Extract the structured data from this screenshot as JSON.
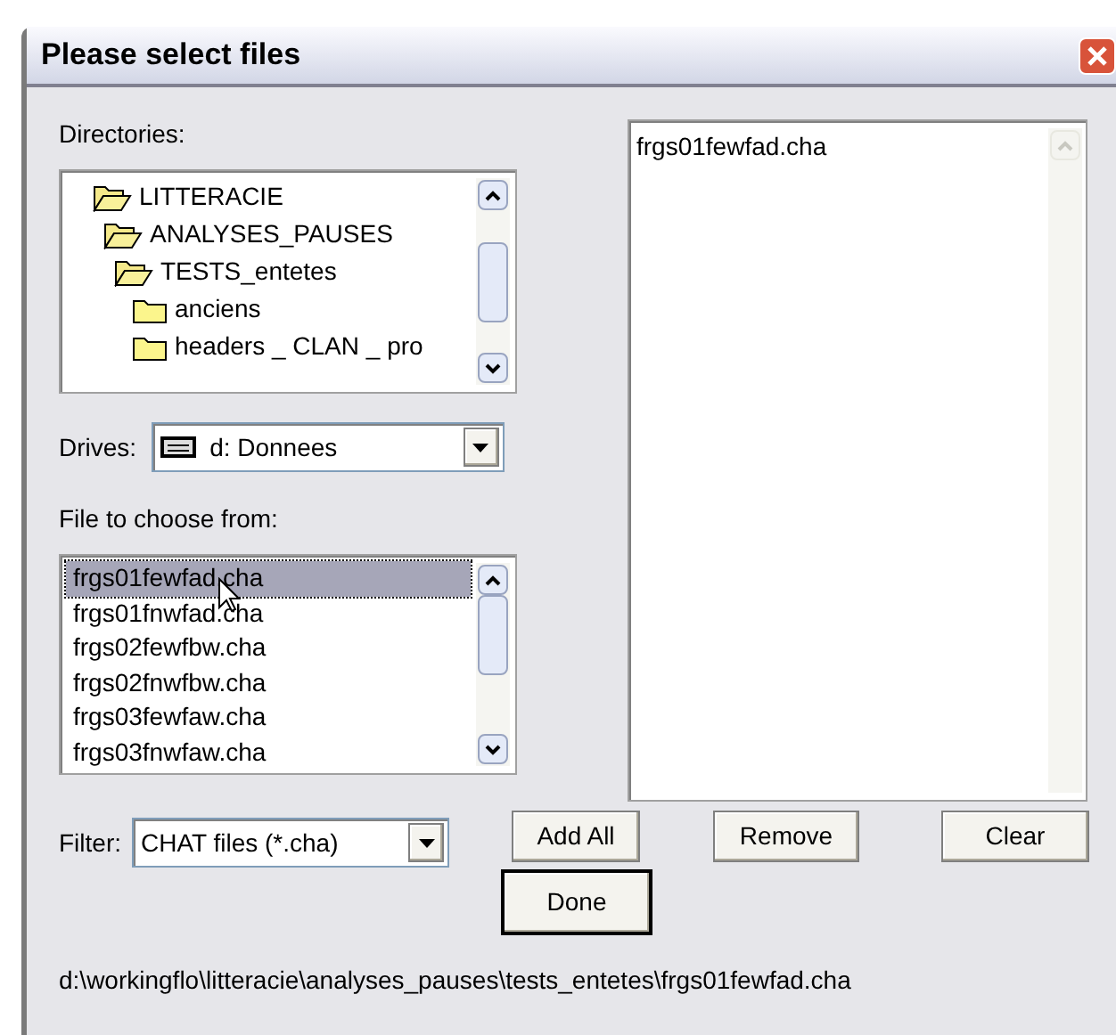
{
  "window": {
    "title": "Please select files"
  },
  "directories": {
    "label": "Directories:",
    "tree": [
      {
        "name": "LITTERACIE",
        "expanded": true,
        "children": [
          {
            "name": "ANALYSES_PAUSES",
            "expanded": true,
            "children": [
              {
                "name": "TESTS_entetes",
                "expanded": true,
                "children": [
                  {
                    "name": "anciens",
                    "expanded": false
                  },
                  {
                    "name": "headers _ CLAN _ pro",
                    "expanded": false
                  }
                ]
              }
            ]
          }
        ]
      }
    ]
  },
  "drives": {
    "label": "Drives:",
    "value": "d: Donnees"
  },
  "files": {
    "label": "File to choose from:",
    "items": [
      {
        "name": "frgs01fewfad.cha",
        "selected": true
      },
      {
        "name": "frgs01fnwfad.cha",
        "selected": false
      },
      {
        "name": "frgs02fewfbw.cha",
        "selected": false
      },
      {
        "name": "frgs02fnwfbw.cha",
        "selected": false
      },
      {
        "name": "frgs03fewfaw.cha",
        "selected": false
      },
      {
        "name": "frgs03fnwfaw.cha",
        "selected": false
      }
    ]
  },
  "filter": {
    "label": "Filter:",
    "value": "CHAT files (*.cha)"
  },
  "chosen_files": [
    "frgs01fewfad.cha"
  ],
  "buttons": {
    "add_all": "Add All",
    "remove": "Remove",
    "clear": "Clear",
    "done": "Done"
  },
  "status_path": "d:\\workingflo\\litteracie\\analyses_pauses\\tests_entetes\\frgs01fewfad.cha"
}
